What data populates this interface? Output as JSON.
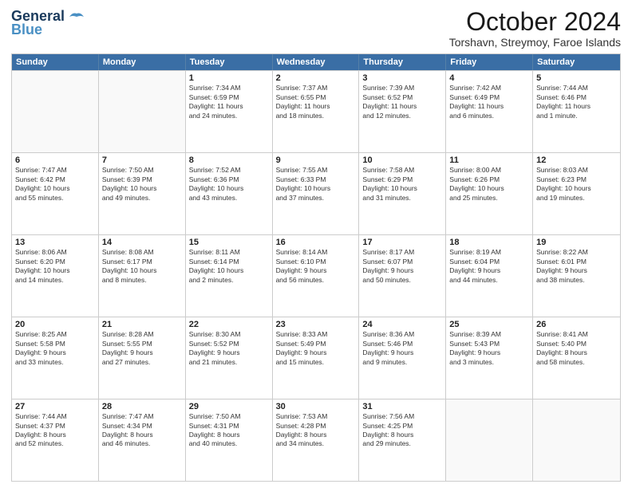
{
  "logo": {
    "line1": "General",
    "line2": "Blue"
  },
  "title": "October 2024",
  "location": "Torshavn, Streymoy, Faroe Islands",
  "headers": [
    "Sunday",
    "Monday",
    "Tuesday",
    "Wednesday",
    "Thursday",
    "Friday",
    "Saturday"
  ],
  "rows": [
    [
      {
        "day": "",
        "lines": []
      },
      {
        "day": "",
        "lines": []
      },
      {
        "day": "1",
        "lines": [
          "Sunrise: 7:34 AM",
          "Sunset: 6:59 PM",
          "Daylight: 11 hours",
          "and 24 minutes."
        ]
      },
      {
        "day": "2",
        "lines": [
          "Sunrise: 7:37 AM",
          "Sunset: 6:55 PM",
          "Daylight: 11 hours",
          "and 18 minutes."
        ]
      },
      {
        "day": "3",
        "lines": [
          "Sunrise: 7:39 AM",
          "Sunset: 6:52 PM",
          "Daylight: 11 hours",
          "and 12 minutes."
        ]
      },
      {
        "day": "4",
        "lines": [
          "Sunrise: 7:42 AM",
          "Sunset: 6:49 PM",
          "Daylight: 11 hours",
          "and 6 minutes."
        ]
      },
      {
        "day": "5",
        "lines": [
          "Sunrise: 7:44 AM",
          "Sunset: 6:46 PM",
          "Daylight: 11 hours",
          "and 1 minute."
        ]
      }
    ],
    [
      {
        "day": "6",
        "lines": [
          "Sunrise: 7:47 AM",
          "Sunset: 6:42 PM",
          "Daylight: 10 hours",
          "and 55 minutes."
        ]
      },
      {
        "day": "7",
        "lines": [
          "Sunrise: 7:50 AM",
          "Sunset: 6:39 PM",
          "Daylight: 10 hours",
          "and 49 minutes."
        ]
      },
      {
        "day": "8",
        "lines": [
          "Sunrise: 7:52 AM",
          "Sunset: 6:36 PM",
          "Daylight: 10 hours",
          "and 43 minutes."
        ]
      },
      {
        "day": "9",
        "lines": [
          "Sunrise: 7:55 AM",
          "Sunset: 6:33 PM",
          "Daylight: 10 hours",
          "and 37 minutes."
        ]
      },
      {
        "day": "10",
        "lines": [
          "Sunrise: 7:58 AM",
          "Sunset: 6:29 PM",
          "Daylight: 10 hours",
          "and 31 minutes."
        ]
      },
      {
        "day": "11",
        "lines": [
          "Sunrise: 8:00 AM",
          "Sunset: 6:26 PM",
          "Daylight: 10 hours",
          "and 25 minutes."
        ]
      },
      {
        "day": "12",
        "lines": [
          "Sunrise: 8:03 AM",
          "Sunset: 6:23 PM",
          "Daylight: 10 hours",
          "and 19 minutes."
        ]
      }
    ],
    [
      {
        "day": "13",
        "lines": [
          "Sunrise: 8:06 AM",
          "Sunset: 6:20 PM",
          "Daylight: 10 hours",
          "and 14 minutes."
        ]
      },
      {
        "day": "14",
        "lines": [
          "Sunrise: 8:08 AM",
          "Sunset: 6:17 PM",
          "Daylight: 10 hours",
          "and 8 minutes."
        ]
      },
      {
        "day": "15",
        "lines": [
          "Sunrise: 8:11 AM",
          "Sunset: 6:14 PM",
          "Daylight: 10 hours",
          "and 2 minutes."
        ]
      },
      {
        "day": "16",
        "lines": [
          "Sunrise: 8:14 AM",
          "Sunset: 6:10 PM",
          "Daylight: 9 hours",
          "and 56 minutes."
        ]
      },
      {
        "day": "17",
        "lines": [
          "Sunrise: 8:17 AM",
          "Sunset: 6:07 PM",
          "Daylight: 9 hours",
          "and 50 minutes."
        ]
      },
      {
        "day": "18",
        "lines": [
          "Sunrise: 8:19 AM",
          "Sunset: 6:04 PM",
          "Daylight: 9 hours",
          "and 44 minutes."
        ]
      },
      {
        "day": "19",
        "lines": [
          "Sunrise: 8:22 AM",
          "Sunset: 6:01 PM",
          "Daylight: 9 hours",
          "and 38 minutes."
        ]
      }
    ],
    [
      {
        "day": "20",
        "lines": [
          "Sunrise: 8:25 AM",
          "Sunset: 5:58 PM",
          "Daylight: 9 hours",
          "and 33 minutes."
        ]
      },
      {
        "day": "21",
        "lines": [
          "Sunrise: 8:28 AM",
          "Sunset: 5:55 PM",
          "Daylight: 9 hours",
          "and 27 minutes."
        ]
      },
      {
        "day": "22",
        "lines": [
          "Sunrise: 8:30 AM",
          "Sunset: 5:52 PM",
          "Daylight: 9 hours",
          "and 21 minutes."
        ]
      },
      {
        "day": "23",
        "lines": [
          "Sunrise: 8:33 AM",
          "Sunset: 5:49 PM",
          "Daylight: 9 hours",
          "and 15 minutes."
        ]
      },
      {
        "day": "24",
        "lines": [
          "Sunrise: 8:36 AM",
          "Sunset: 5:46 PM",
          "Daylight: 9 hours",
          "and 9 minutes."
        ]
      },
      {
        "day": "25",
        "lines": [
          "Sunrise: 8:39 AM",
          "Sunset: 5:43 PM",
          "Daylight: 9 hours",
          "and 3 minutes."
        ]
      },
      {
        "day": "26",
        "lines": [
          "Sunrise: 8:41 AM",
          "Sunset: 5:40 PM",
          "Daylight: 8 hours",
          "and 58 minutes."
        ]
      }
    ],
    [
      {
        "day": "27",
        "lines": [
          "Sunrise: 7:44 AM",
          "Sunset: 4:37 PM",
          "Daylight: 8 hours",
          "and 52 minutes."
        ]
      },
      {
        "day": "28",
        "lines": [
          "Sunrise: 7:47 AM",
          "Sunset: 4:34 PM",
          "Daylight: 8 hours",
          "and 46 minutes."
        ]
      },
      {
        "day": "29",
        "lines": [
          "Sunrise: 7:50 AM",
          "Sunset: 4:31 PM",
          "Daylight: 8 hours",
          "and 40 minutes."
        ]
      },
      {
        "day": "30",
        "lines": [
          "Sunrise: 7:53 AM",
          "Sunset: 4:28 PM",
          "Daylight: 8 hours",
          "and 34 minutes."
        ]
      },
      {
        "day": "31",
        "lines": [
          "Sunrise: 7:56 AM",
          "Sunset: 4:25 PM",
          "Daylight: 8 hours",
          "and 29 minutes."
        ]
      },
      {
        "day": "",
        "lines": []
      },
      {
        "day": "",
        "lines": []
      }
    ]
  ]
}
